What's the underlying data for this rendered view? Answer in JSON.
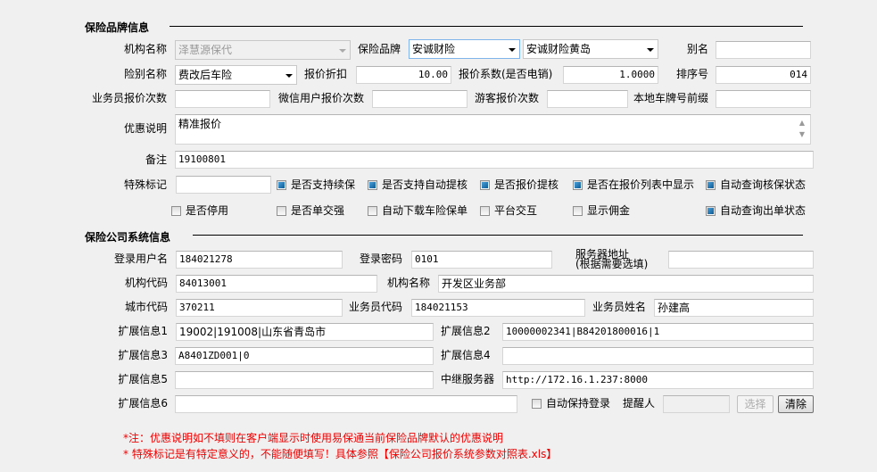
{
  "section1": {
    "title": "保险品牌信息",
    "org_name_label": "机构名称",
    "org_name_value": "泽慧源保代",
    "brand_label": "保险品牌",
    "brand_value": "安诚财险",
    "sub_brand_value": "安诚财险黄岛",
    "alias_label": "别名",
    "alias_value": "",
    "insurance_type_label": "险别名称",
    "insurance_type_value": "费改后车险",
    "discount_label": "报价折扣",
    "discount_value": "10.00",
    "coef_label": "报价系数(是否电销)",
    "coef_value": "1.0000",
    "order_label": "排序号",
    "order_value": "014",
    "agent_quotes_label": "业务员报价次数",
    "agent_quotes_value": "",
    "wechat_quotes_label": "微信用户报价次数",
    "wechat_quotes_value": "",
    "guest_quotes_label": "游客报价次数",
    "guest_quotes_value": "",
    "plate_prefix_label": "本地车牌号前缀",
    "plate_prefix_value": "",
    "promo_label": "优惠说明",
    "promo_value": "精准报价",
    "remark_label": "备注",
    "remark_value": "19100801",
    "special_label": "特殊标记",
    "special_value": "",
    "checkboxes": [
      {
        "label": "是否支持续保",
        "checked": true
      },
      {
        "label": "是否支持自动提核",
        "checked": true
      },
      {
        "label": "是否报价提核",
        "checked": true
      },
      {
        "label": "是否在报价列表中显示",
        "checked": true
      },
      {
        "label": "自动查询核保状态",
        "checked": true
      },
      {
        "label": "是否停用",
        "checked": false
      },
      {
        "label": "是否单交强",
        "checked": false
      },
      {
        "label": "自动下载车险保单",
        "checked": false
      },
      {
        "label": "平台交互",
        "checked": false
      },
      {
        "label": "显示佣金",
        "checked": false
      },
      {
        "label": "自动查询出单状态",
        "checked": true
      }
    ]
  },
  "section2": {
    "title": "保险公司系统信息",
    "login_user_label": "登录用户名",
    "login_user_value": "184021278",
    "login_pwd_label": "登录密码",
    "login_pwd_value": "0101",
    "server_label_1": "服务器地址",
    "server_label_2": "(根据需要选填)",
    "server_value": "",
    "org_code_label": "机构代码",
    "org_code_value": "84013001",
    "org_name_label": "机构名称",
    "org_name_value": "开发区业务部",
    "city_code_label": "城市代码",
    "city_code_value": "370211",
    "agent_code_label": "业务员代码",
    "agent_code_value": "184021153",
    "agent_name_label": "业务员姓名",
    "agent_name_value": "孙建高",
    "ext1_label": "扩展信息1",
    "ext1_value": "19002|191008|山东省青岛市",
    "ext2_label": "扩展信息2",
    "ext2_value": "10000002341|B84201800016|1",
    "ext3_label": "扩展信息3",
    "ext3_value": "A8401ZD001|0",
    "ext4_label": "扩展信息4",
    "ext4_value": "",
    "ext5_label": "扩展信息5",
    "ext5_value": "",
    "relay_label": "中继服务器",
    "relay_value": "http://172.16.1.237:8000",
    "ext6_label": "扩展信息6",
    "ext6_value": "",
    "keep_login_label": "自动保持登录",
    "keep_login_checked": false,
    "reminder_label": "提醒人",
    "reminder_value": "",
    "select_button": "选择",
    "clear_button": "清除"
  },
  "notes": [
    "*注：优惠说明如不填则在客户端显示时使用易保通当前保险品牌默认的优惠说明",
    "* 特殊标记是有特定意义的，不能随便填写！具体参照【保险公司报价系统参数对照表.xls】"
  ]
}
